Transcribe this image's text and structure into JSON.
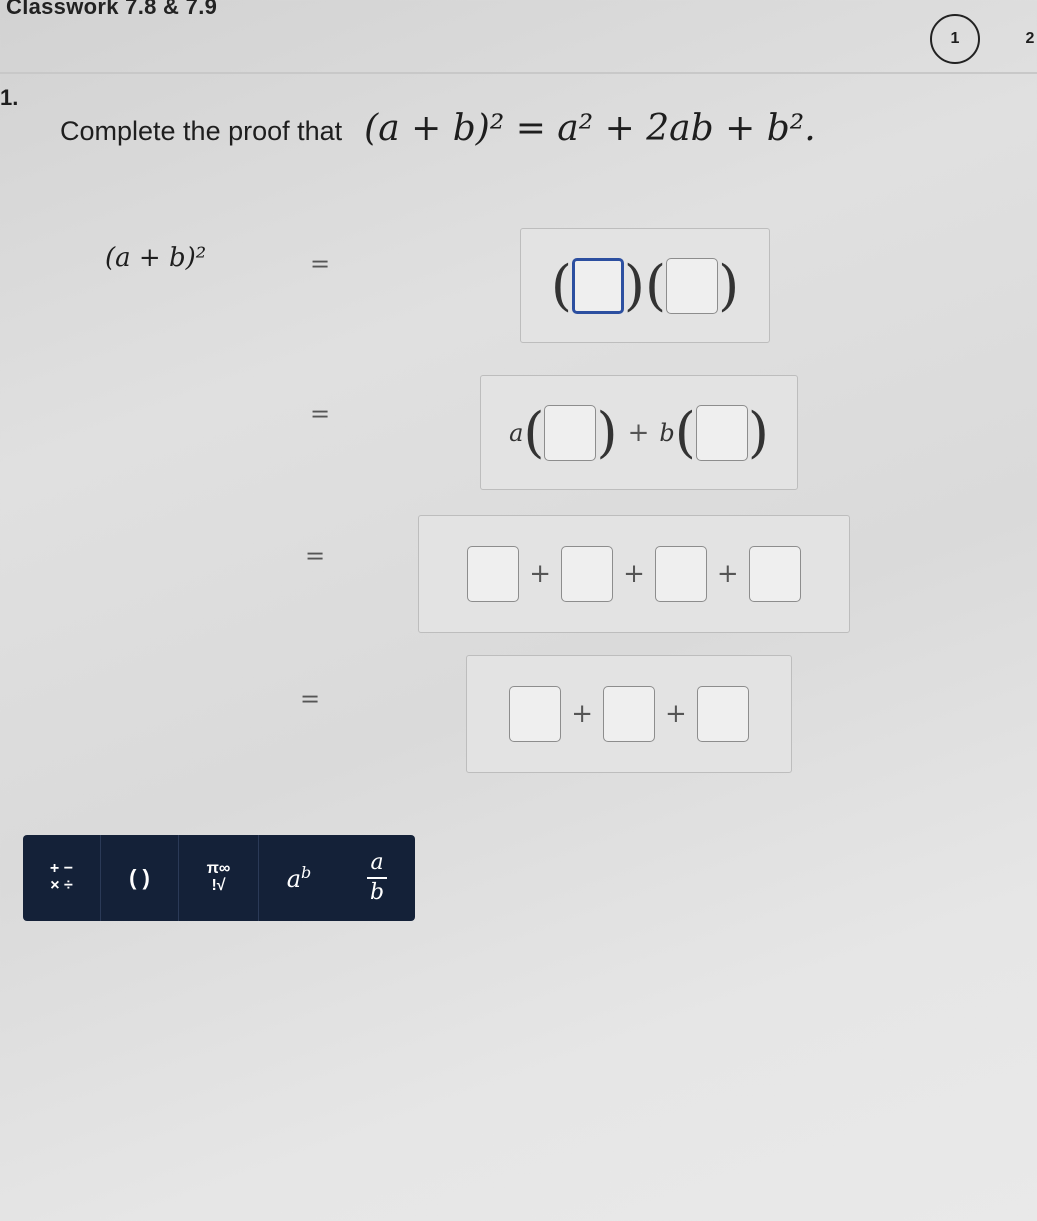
{
  "header": {
    "title": "Classwork 7.8 & 7.9",
    "pages": [
      "1",
      "2"
    ],
    "active_page": "1"
  },
  "question": {
    "number": "1.",
    "prompt_text": "Complete the proof that",
    "identity": "(a + b)² = a² + 2ab + b²."
  },
  "proof": {
    "lhs": "(a + b)²",
    "equals": "=",
    "plus": "+",
    "open_paren": "(",
    "close_paren": ")",
    "coef_a": "a",
    "coef_b": "b"
  },
  "toolbar": {
    "ops_top": "+ −",
    "ops_bottom": "× ÷",
    "parens": "( )",
    "special_top": "π∞",
    "special_bottom": "!√",
    "power_base": "a",
    "power_exp": "b",
    "frac_num": "a",
    "frac_den": "b"
  },
  "colors": {
    "toolbar_bg": "#142138",
    "active_blank_border": "#2c4fa0"
  }
}
